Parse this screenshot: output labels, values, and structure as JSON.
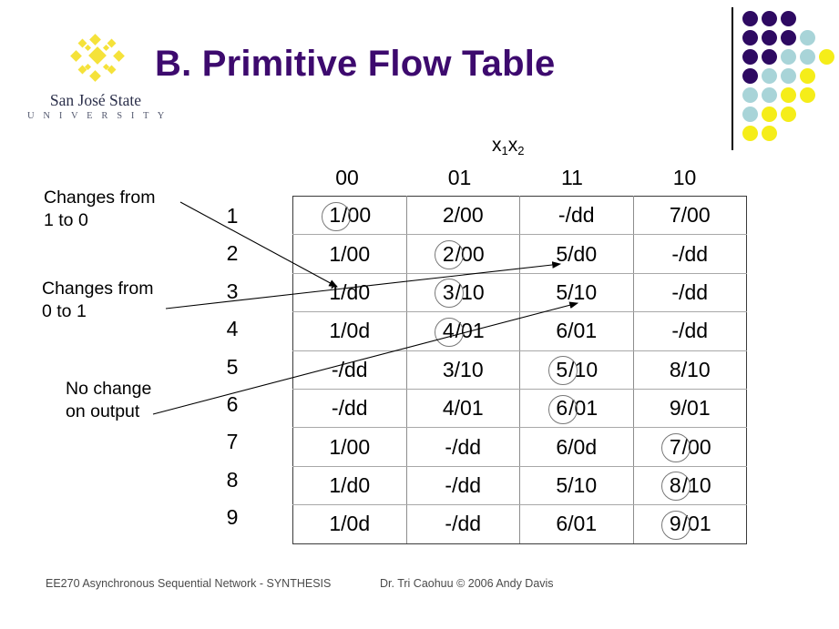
{
  "slide": {
    "title": "B. Primitive Flow Table"
  },
  "logo": {
    "name": "San José State",
    "subtitle": "U N I V E R S I T Y",
    "diamond_color": "#f5e23a",
    "wordmark_color": "#2b2f4a"
  },
  "decoration": {
    "purple": "#2e0a62",
    "teal": "#a8d4d8",
    "yellow": "#f5ed19",
    "dots": [
      {
        "row": 0,
        "col": 0,
        "color": "purple"
      },
      {
        "row": 0,
        "col": 1,
        "color": "purple"
      },
      {
        "row": 0,
        "col": 2,
        "color": "purple"
      },
      {
        "row": 1,
        "col": 0,
        "color": "purple"
      },
      {
        "row": 1,
        "col": 1,
        "color": "purple"
      },
      {
        "row": 1,
        "col": 2,
        "color": "purple"
      },
      {
        "row": 1,
        "col": 3,
        "color": "teal"
      },
      {
        "row": 2,
        "col": 0,
        "color": "purple"
      },
      {
        "row": 2,
        "col": 1,
        "color": "purple"
      },
      {
        "row": 2,
        "col": 2,
        "color": "teal"
      },
      {
        "row": 2,
        "col": 3,
        "color": "teal"
      },
      {
        "row": 2,
        "col": 4,
        "color": "yellow"
      },
      {
        "row": 3,
        "col": 0,
        "color": "purple"
      },
      {
        "row": 3,
        "col": 1,
        "color": "teal"
      },
      {
        "row": 3,
        "col": 2,
        "color": "teal"
      },
      {
        "row": 3,
        "col": 3,
        "color": "yellow"
      },
      {
        "row": 4,
        "col": 0,
        "color": "teal"
      },
      {
        "row": 4,
        "col": 1,
        "color": "teal"
      },
      {
        "row": 4,
        "col": 2,
        "color": "yellow"
      },
      {
        "row": 4,
        "col": 3,
        "color": "yellow"
      },
      {
        "row": 5,
        "col": 0,
        "color": "teal"
      },
      {
        "row": 5,
        "col": 1,
        "color": "yellow"
      },
      {
        "row": 5,
        "col": 2,
        "color": "yellow"
      },
      {
        "row": 6,
        "col": 0,
        "color": "yellow"
      },
      {
        "row": 6,
        "col": 1,
        "color": "yellow"
      }
    ]
  },
  "table": {
    "axis_label_base": "x",
    "axis_label_sub1": "1",
    "axis_label_sub2": "2",
    "column_headers": [
      "00",
      "01",
      "11",
      "10"
    ],
    "row_labels": [
      "1",
      "2",
      "3",
      "4",
      "5",
      "6",
      "7",
      "8",
      "9"
    ],
    "rows": [
      [
        {
          "state": "1",
          "output": "00",
          "circled": true
        },
        {
          "state": "2",
          "output": "00",
          "circled": false
        },
        {
          "state": "-",
          "output": "dd",
          "circled": false
        },
        {
          "state": "7",
          "output": "00",
          "circled": false
        }
      ],
      [
        {
          "state": "1",
          "output": "00",
          "circled": false
        },
        {
          "state": "2",
          "output": "00",
          "circled": true
        },
        {
          "state": "5",
          "output": "d0",
          "circled": false
        },
        {
          "state": "-",
          "output": "dd",
          "circled": false
        }
      ],
      [
        {
          "state": "1",
          "output": "d0",
          "circled": false
        },
        {
          "state": "3",
          "output": "10",
          "circled": true
        },
        {
          "state": "5",
          "output": "10",
          "circled": false
        },
        {
          "state": "-",
          "output": "dd",
          "circled": false
        }
      ],
      [
        {
          "state": "1",
          "output": "0d",
          "circled": false
        },
        {
          "state": "4",
          "output": "01",
          "circled": true
        },
        {
          "state": "6",
          "output": "01",
          "circled": false
        },
        {
          "state": "-",
          "output": "dd",
          "circled": false
        }
      ],
      [
        {
          "state": "-",
          "output": "dd",
          "circled": false
        },
        {
          "state": "3",
          "output": "10",
          "circled": false
        },
        {
          "state": "5",
          "output": "10",
          "circled": true
        },
        {
          "state": "8",
          "output": "10",
          "circled": false
        }
      ],
      [
        {
          "state": "-",
          "output": "dd",
          "circled": false
        },
        {
          "state": "4",
          "output": "01",
          "circled": false
        },
        {
          "state": "6",
          "output": "01",
          "circled": true
        },
        {
          "state": "9",
          "output": "01",
          "circled": false
        }
      ],
      [
        {
          "state": "1",
          "output": "00",
          "circled": false
        },
        {
          "state": "-",
          "output": "dd",
          "circled": false
        },
        {
          "state": "6",
          "output": "0d",
          "circled": false
        },
        {
          "state": "7",
          "output": "00",
          "circled": true
        }
      ],
      [
        {
          "state": "1",
          "output": "d0",
          "circled": false
        },
        {
          "state": "-",
          "output": "dd",
          "circled": false
        },
        {
          "state": "5",
          "output": "10",
          "circled": false
        },
        {
          "state": "8",
          "output": "10",
          "circled": true
        }
      ],
      [
        {
          "state": "1",
          "output": "0d",
          "circled": false
        },
        {
          "state": "-",
          "output": "dd",
          "circled": false
        },
        {
          "state": "6",
          "output": "01",
          "circled": false
        },
        {
          "state": "9",
          "output": "01",
          "circled": true
        }
      ]
    ]
  },
  "annotations": [
    {
      "id": "changes-1-to-0",
      "text": "Changes from\n1 to 0"
    },
    {
      "id": "changes-0-to-1",
      "text": "Changes from\n0 to 1"
    },
    {
      "id": "no-change-on-output",
      "text": "No change\non output"
    }
  ],
  "footer": {
    "left": "EE270 Asynchronous Sequential Network - SYNTHESIS",
    "right": "Dr. Tri Caohuu © 2006 Andy Davis"
  }
}
